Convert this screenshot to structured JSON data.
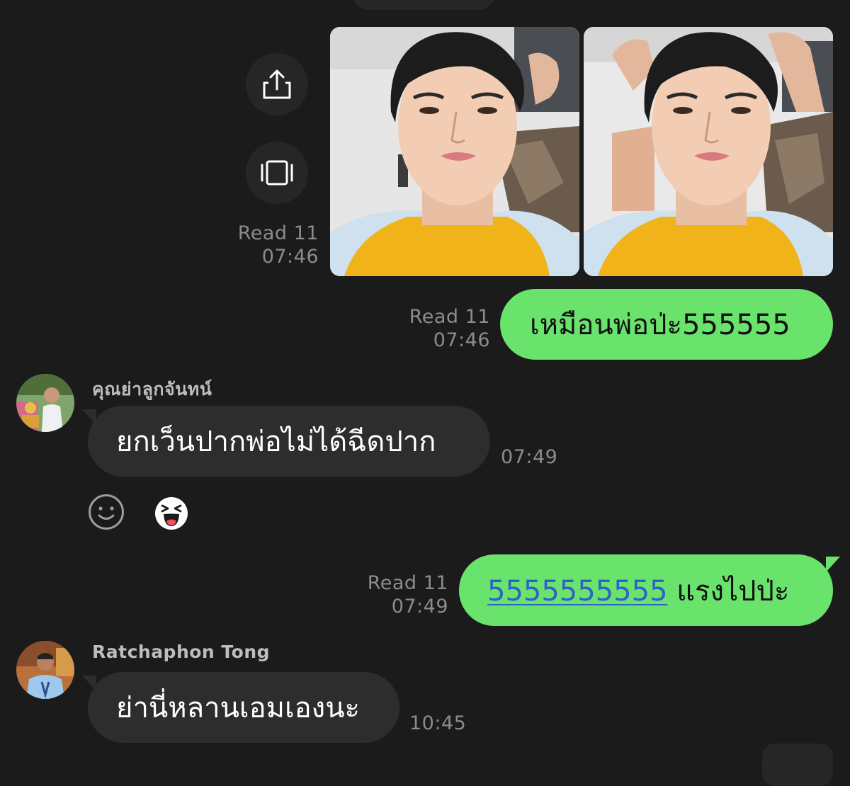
{
  "chat": {
    "photos_meta": {
      "read": "Read 11",
      "time": "07:46"
    },
    "message_1": {
      "text": "เหมือนพ่อป่ะ555555",
      "read": "Read 11",
      "time": "07:46"
    },
    "message_2": {
      "sender": "คุณย่าลูกจันทน์",
      "text": "ยกเว็นปากพ่อไม่ได้ฉีดปาก",
      "time": "07:49"
    },
    "message_3": {
      "link_text": "5555555555",
      "text": " แรงไปป่ะ",
      "read": "Read 11",
      "time": "07:49"
    },
    "message_4": {
      "sender": "Ratchaphon Tong",
      "text": "ย่านี่หลานเอมเองนะ",
      "time": "10:45"
    }
  },
  "icons": {
    "share": "share-icon",
    "slideshow": "slideshow-icon",
    "add_reaction": "add-reaction-icon",
    "laughing_reaction": "laughing-face-icon"
  },
  "colors": {
    "background": "#1b1b1b",
    "outgoing_bubble": "#6ae36d",
    "incoming_bubble": "#2d2d2d",
    "link": "#2d63c8",
    "meta_text": "#8c8c8c"
  }
}
